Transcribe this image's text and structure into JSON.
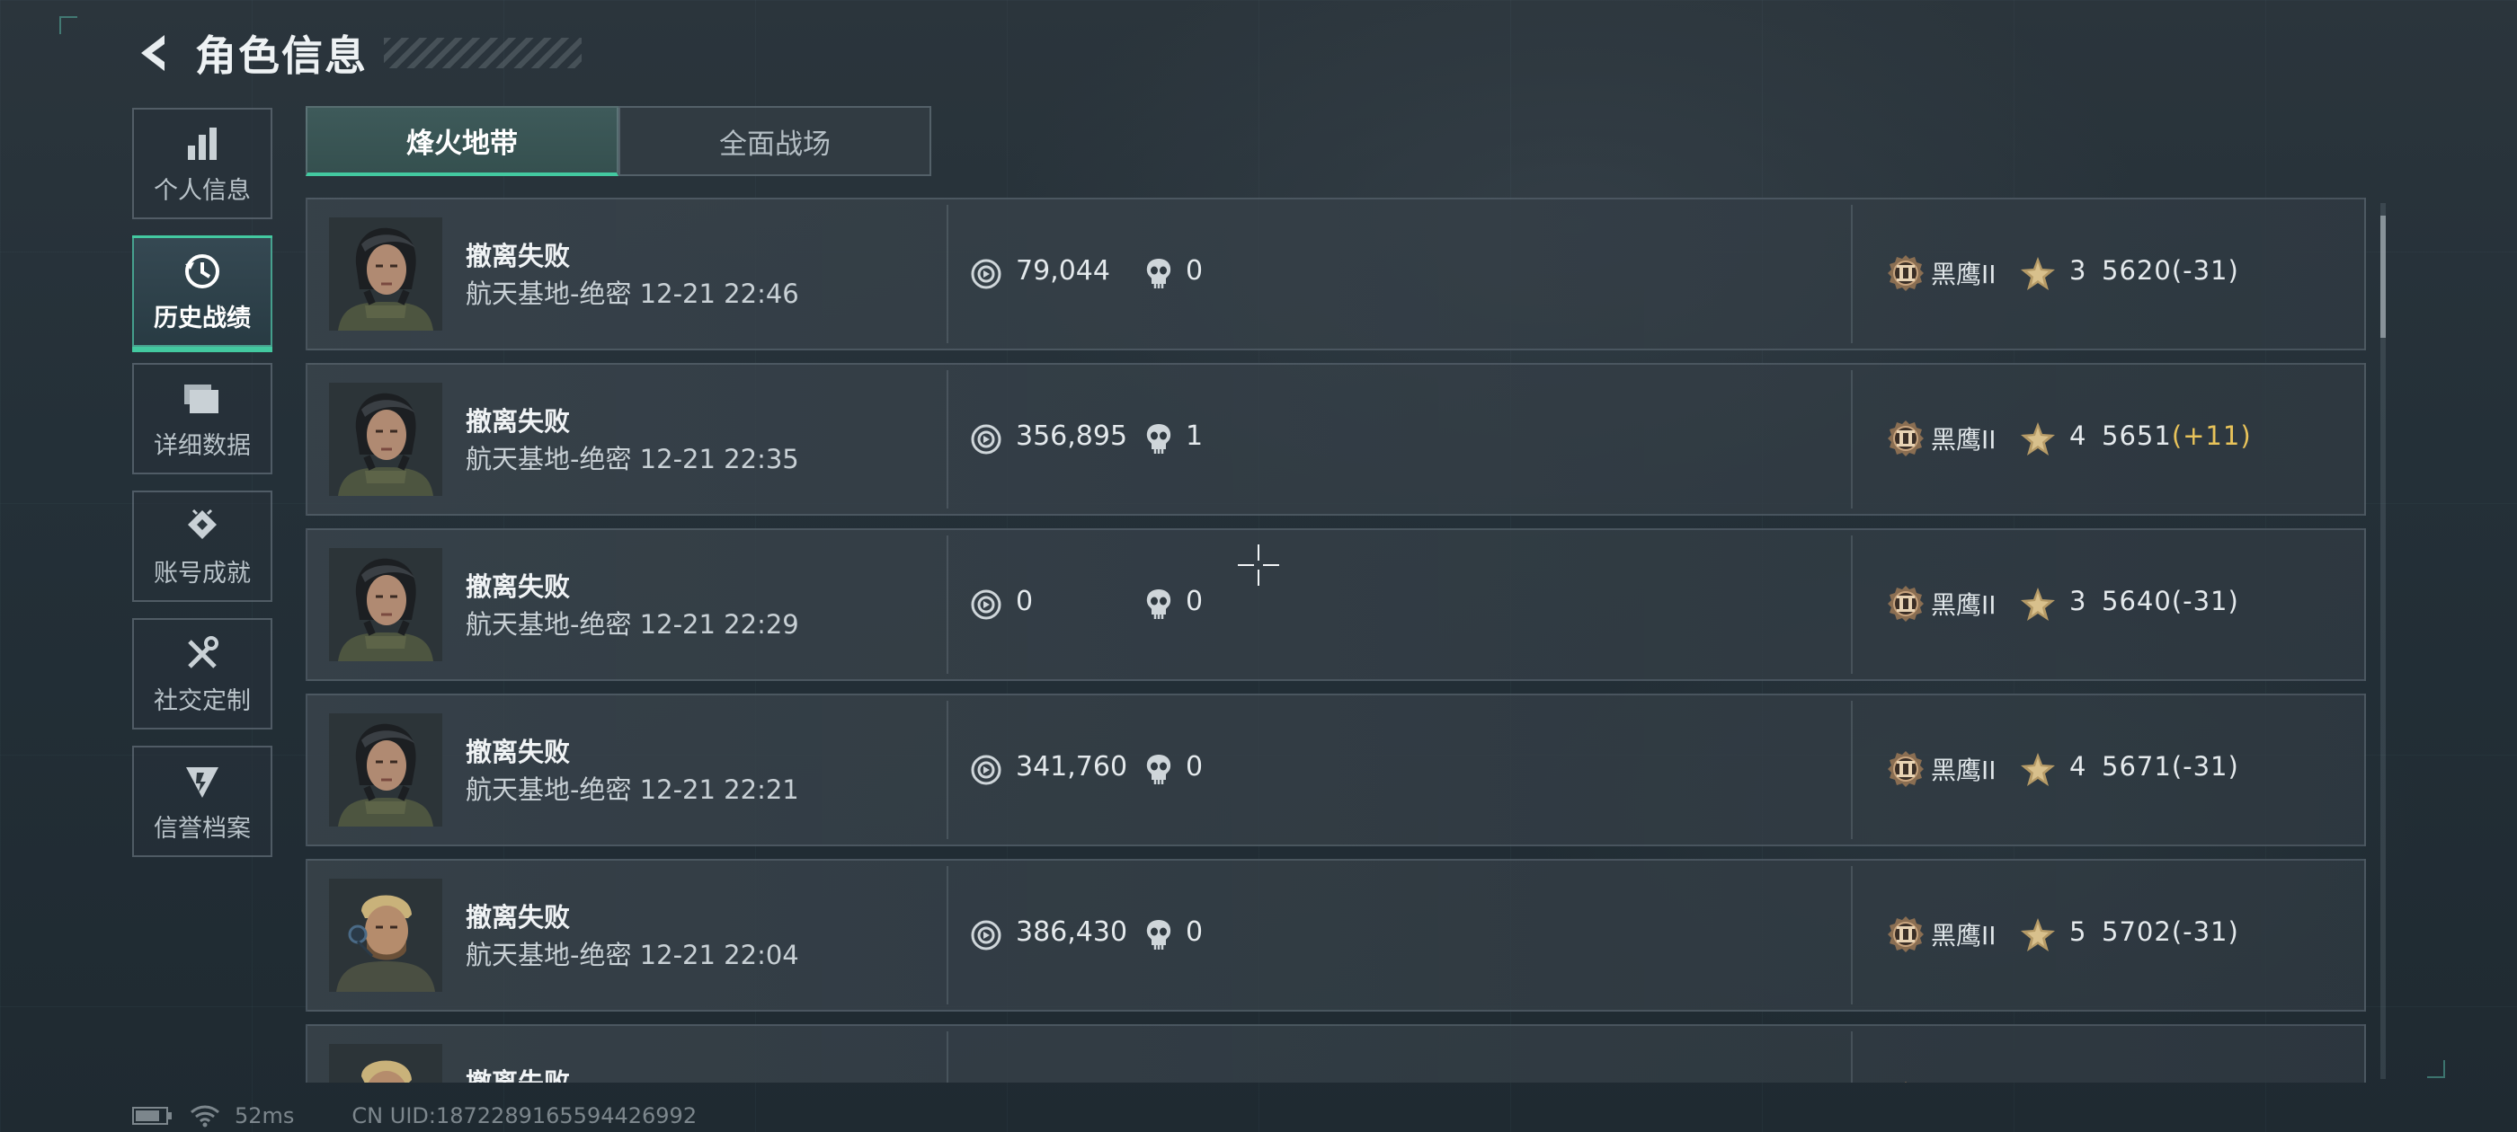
{
  "header": {
    "title": "角色信息"
  },
  "sidebar": {
    "items": [
      {
        "label": "个人信息",
        "icon": "bar-chart-icon"
      },
      {
        "label": "历史战绩",
        "icon": "history-icon",
        "active": true
      },
      {
        "label": "详细数据",
        "icon": "folder-stack-icon"
      },
      {
        "label": "账号成就",
        "icon": "achievement-icon"
      },
      {
        "label": "社交定制",
        "icon": "tools-icon"
      },
      {
        "label": "信誉档案",
        "icon": "credit-shield-icon"
      }
    ]
  },
  "tabs": [
    {
      "label": "烽火地带",
      "active": true
    },
    {
      "label": "全面战场",
      "active": false
    }
  ],
  "rows": [
    {
      "result": "撤离失败",
      "map_time": "航天基地-绝密 12-21 22:46",
      "value": "79,044",
      "kills": "0",
      "rank": "黑鹰II",
      "stars": "3",
      "score": "5620",
      "delta": "(-31)",
      "delta_positive": false,
      "avatar": "female-operator"
    },
    {
      "result": "撤离失败",
      "map_time": "航天基地-绝密 12-21 22:35",
      "value": "356,895",
      "kills": "1",
      "rank": "黑鹰II",
      "stars": "4",
      "score": "5651",
      "delta": "(+11)",
      "delta_positive": true,
      "avatar": "female-operator"
    },
    {
      "result": "撤离失败",
      "map_time": "航天基地-绝密 12-21 22:29",
      "value": "0",
      "kills": "0",
      "rank": "黑鹰II",
      "stars": "3",
      "score": "5640",
      "delta": "(-31)",
      "delta_positive": false,
      "avatar": "female-operator"
    },
    {
      "result": "撤离失败",
      "map_time": "航天基地-绝密 12-21 22:21",
      "value": "341,760",
      "kills": "0",
      "rank": "黑鹰II",
      "stars": "4",
      "score": "5671",
      "delta": "(-31)",
      "delta_positive": false,
      "avatar": "female-operator"
    },
    {
      "result": "撤离失败",
      "map_time": "航天基地-绝密 12-21 22:04",
      "value": "386,430",
      "kills": "0",
      "rank": "黑鹰II",
      "stars": "5",
      "score": "5702",
      "delta": "(-31)",
      "delta_positive": false,
      "avatar": "male-operator"
    },
    {
      "result": "撤离失败",
      "map_time": "",
      "value": "",
      "kills": "",
      "rank": "",
      "stars": "",
      "score": "",
      "delta": "",
      "delta_positive": false,
      "avatar": "male-operator"
    }
  ],
  "status": {
    "ping": "52ms",
    "uid": "CN UID:1872289165594426992"
  },
  "colors": {
    "accent": "#43c9a0",
    "gold": "#e8c35a"
  }
}
